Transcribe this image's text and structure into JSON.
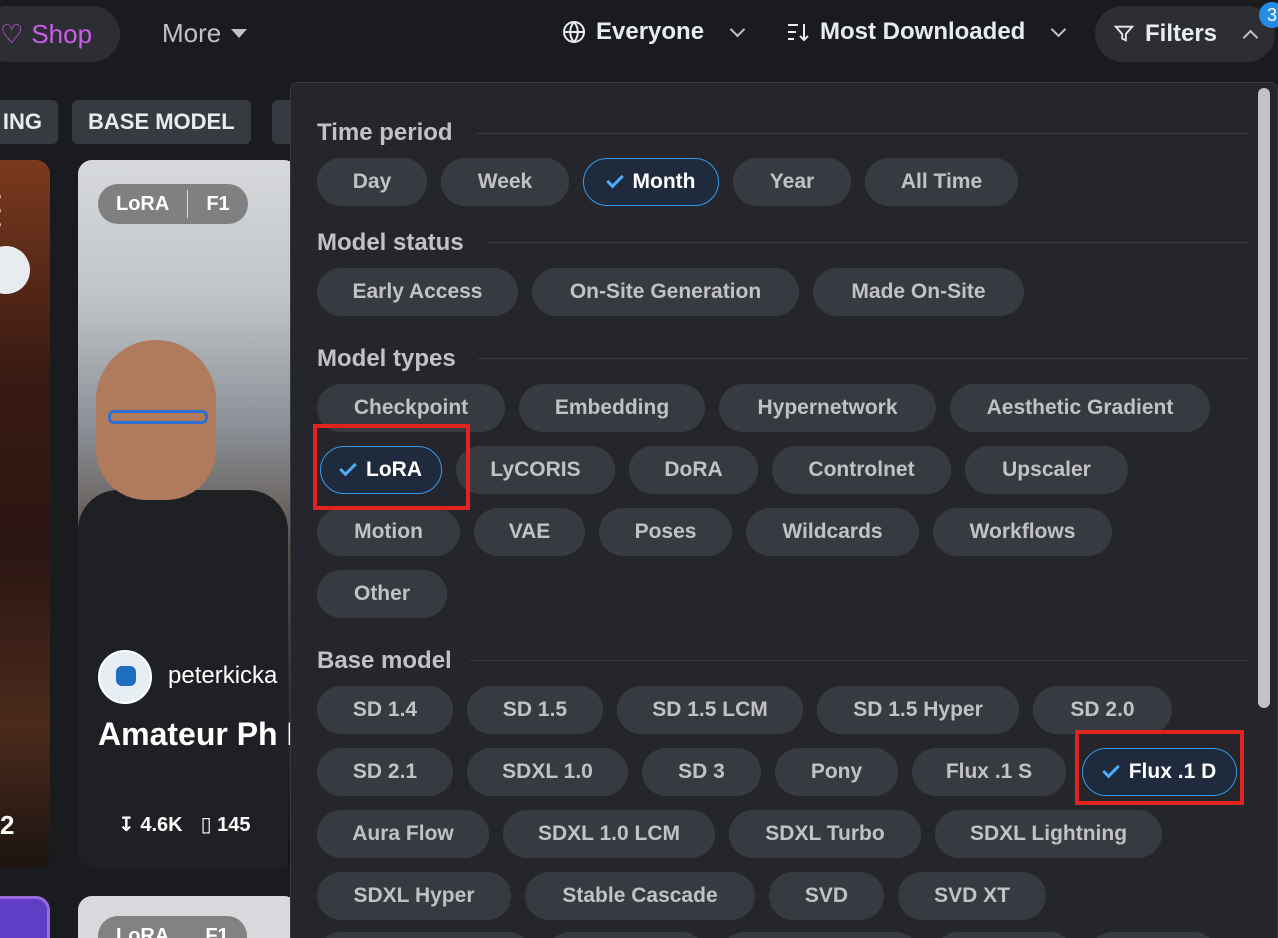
{
  "topbar": {
    "shop_label": "Shop",
    "more_label": "More",
    "audience_label": "Everyone",
    "sort_label": "Most Downloaded",
    "filters_label": "Filters",
    "filters_count": "3"
  },
  "category_chips": [
    "ING",
    "BASE MODEL"
  ],
  "card": {
    "tags": [
      "LoRA",
      "F1"
    ],
    "username": "peterkicka",
    "title": "Amateur Ph Dev]",
    "downloads": "4.6K",
    "bookmarks": "145",
    "left_count": "2"
  },
  "filters": {
    "time_period": {
      "label": "Time period",
      "options": [
        "Day",
        "Week",
        "Month",
        "Year",
        "All Time"
      ],
      "selected": "Month"
    },
    "model_status": {
      "label": "Model status",
      "options": [
        "Early Access",
        "On-Site Generation",
        "Made On-Site"
      ]
    },
    "model_types": {
      "label": "Model types",
      "options": [
        "Checkpoint",
        "Embedding",
        "Hypernetwork",
        "Aesthetic Gradient",
        "LoRA",
        "LyCORIS",
        "DoRA",
        "Controlnet",
        "Upscaler",
        "Motion",
        "VAE",
        "Poses",
        "Wildcards",
        "Workflows",
        "Other"
      ],
      "selected": "LoRA"
    },
    "base_model": {
      "label": "Base model",
      "options": [
        "SD 1.4",
        "SD 1.5",
        "SD 1.5 LCM",
        "SD 1.5 Hyper",
        "SD 2.0",
        "SD 2.1",
        "SDXL 1.0",
        "SD 3",
        "Pony",
        "Flux .1 S",
        "Flux .1 D",
        "Aura Flow",
        "SDXL 1.0 LCM",
        "SDXL Turbo",
        "SDXL Lightning",
        "SDXL Hyper",
        "Stable Cascade",
        "SVD",
        "SVD XT"
      ],
      "selected": "Flux .1 D"
    }
  },
  "colors": {
    "accent": "#339af0",
    "highlight": "#e0231e",
    "shop": "#cc5de8"
  }
}
